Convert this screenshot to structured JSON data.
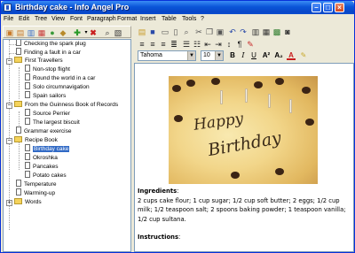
{
  "window": {
    "title": "Birthday cake - Info Angel Pro"
  },
  "menu": [
    "File",
    "Edit",
    "Tree",
    "View",
    "Font",
    "Paragraph",
    "Format",
    "Insert",
    "Table",
    "Tools",
    "?"
  ],
  "tree": [
    {
      "label": "Checking the spark plug",
      "type": "doc",
      "level": 1
    },
    {
      "label": "Finding a fault in a car",
      "type": "doc",
      "level": 1
    },
    {
      "label": "First Travellers",
      "type": "folder",
      "level": 0,
      "expanded": true
    },
    {
      "label": "Non-stop flight",
      "type": "doc",
      "level": 2
    },
    {
      "label": "Round the world in a car",
      "type": "doc",
      "level": 2
    },
    {
      "label": "Solo circumnavigation",
      "type": "doc",
      "level": 2
    },
    {
      "label": "Spain sailors",
      "type": "doc",
      "level": 2
    },
    {
      "label": "From the Guinness Book of Records",
      "type": "folder",
      "level": 0,
      "expanded": true
    },
    {
      "label": "Source Perrier",
      "type": "doc",
      "level": 2
    },
    {
      "label": "The largest biscuit",
      "type": "doc",
      "level": 2
    },
    {
      "label": "Grammar exercise",
      "type": "doc",
      "level": 1
    },
    {
      "label": "Recipe Book",
      "type": "folder",
      "level": 0,
      "expanded": true
    },
    {
      "label": "Birthday cake",
      "type": "doc",
      "level": 2,
      "selected": true
    },
    {
      "label": "Okroshka",
      "type": "doc",
      "level": 2
    },
    {
      "label": "Pancakes",
      "type": "doc",
      "level": 2
    },
    {
      "label": "Potato cakes",
      "type": "doc",
      "level": 2
    },
    {
      "label": "Temperature",
      "type": "doc",
      "level": 1
    },
    {
      "label": "Warming-up",
      "type": "doc",
      "level": 1
    },
    {
      "label": "Words",
      "type": "folder",
      "level": 0,
      "expanded": false
    }
  ],
  "format": {
    "font": "Tahoma",
    "size": "10"
  },
  "document": {
    "image_text_1": "Happy",
    "image_text_2": "Birthday",
    "ingredients_heading": "Ingredients",
    "ingredients_text": "2 cups cake flour; 1 cup sugar; 1/2 cup soft butter; 2 eggs; 1/2 cup milk; 1/2 teaspoon salt; 2 spoons baking powder; 1 teaspoon vanilla; 1/2 cup sultana.",
    "instructions_heading": "Instructions"
  },
  "colors": {
    "title_bar": "#0a55d8",
    "selection": "#316ac5",
    "folder": "#f5d35b"
  }
}
